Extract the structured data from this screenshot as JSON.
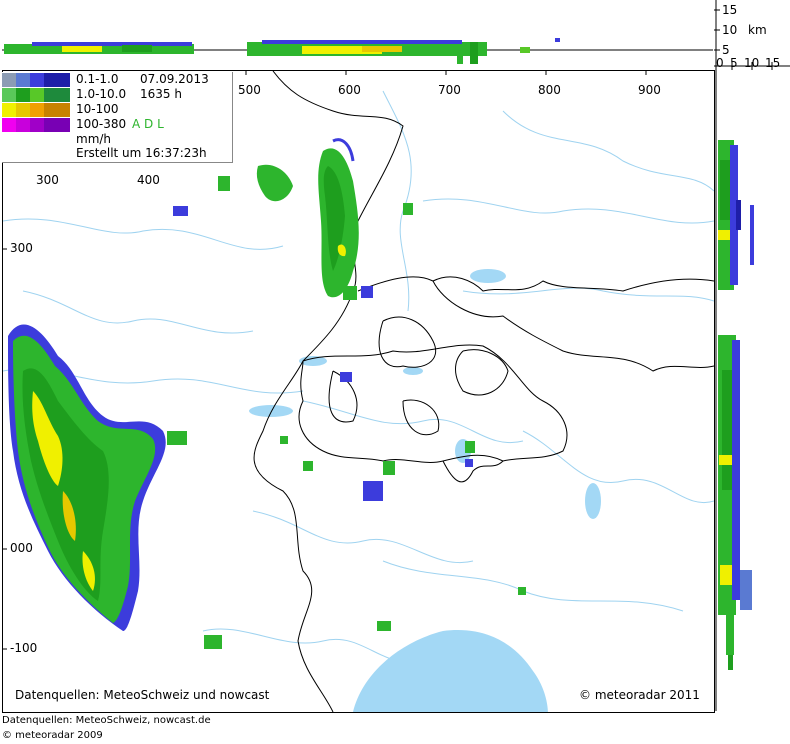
{
  "map": {
    "x_ticks_top": [
      "500",
      "600",
      "700",
      "800",
      "900"
    ],
    "x_ticks_left": [
      "300",
      "400"
    ],
    "y_ticks": [
      "300",
      "000",
      "-100"
    ]
  },
  "legend": {
    "ranges": [
      "0.1-1.0",
      "1.0-10.0",
      "10-100",
      "100-380"
    ],
    "unit": "mm/h",
    "date": "07.09.2013",
    "time": "1635 h",
    "adl": "A D L",
    "created": "Erstellt um 16:37:23h",
    "colors": [
      [
        "#8c9cb4",
        "#5a7ad2",
        "#3c3cdc",
        "#1e1ea8"
      ],
      [
        "#5ac85a",
        "#1e9e1e",
        "#58c828",
        "#1e8a3c"
      ],
      [
        "#f0f000",
        "#e6c800",
        "#f0a000",
        "#c88200"
      ],
      [
        "#f000f0",
        "#c800dc",
        "#a000c8",
        "#7800b4"
      ]
    ]
  },
  "top_scale": {
    "labels": [
      "15",
      "10",
      "km",
      "5",
      "0",
      "5",
      "10",
      "15"
    ]
  },
  "credits": {
    "source_inner": "Datenquellen: MeteoSchweiz und nowcast",
    "copyright_inner": "© meteoradar 2011",
    "source_footer": "Datenquellen: MeteoSchweiz, nowcast.de",
    "copyright_footer": "© meteoradar 2009"
  }
}
